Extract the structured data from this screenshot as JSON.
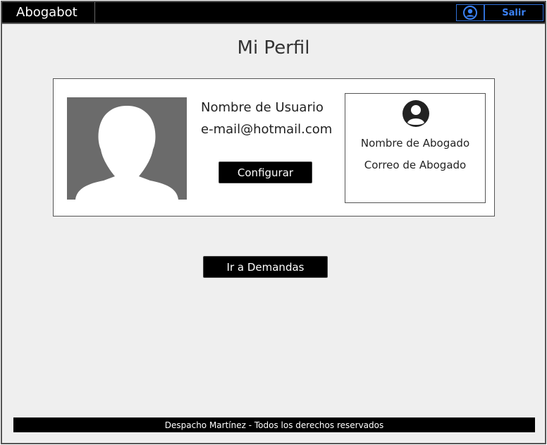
{
  "header": {
    "brand": "Abogabot",
    "logout_label": "Salir",
    "user_icon": "user-circle-icon"
  },
  "page": {
    "title": "Mi Perfil"
  },
  "profile": {
    "avatar_icon": "avatar-placeholder-icon",
    "username": "Nombre de Usuario",
    "email": "e-mail@hotmail.com",
    "configure_label": "Configurar"
  },
  "lawyer": {
    "icon": "user-circle-icon",
    "name": "Nombre de Abogado",
    "email": "Correo de Abogado"
  },
  "actions": {
    "demands_label": "Ir a Demandas"
  },
  "footer": {
    "text": "Despacho Martínez - Todos los derechos reservados"
  },
  "colors": {
    "accent": "#3b82f6",
    "header_bg": "#000000",
    "page_bg": "#efefef",
    "avatar_bg": "#6b6b6b"
  }
}
